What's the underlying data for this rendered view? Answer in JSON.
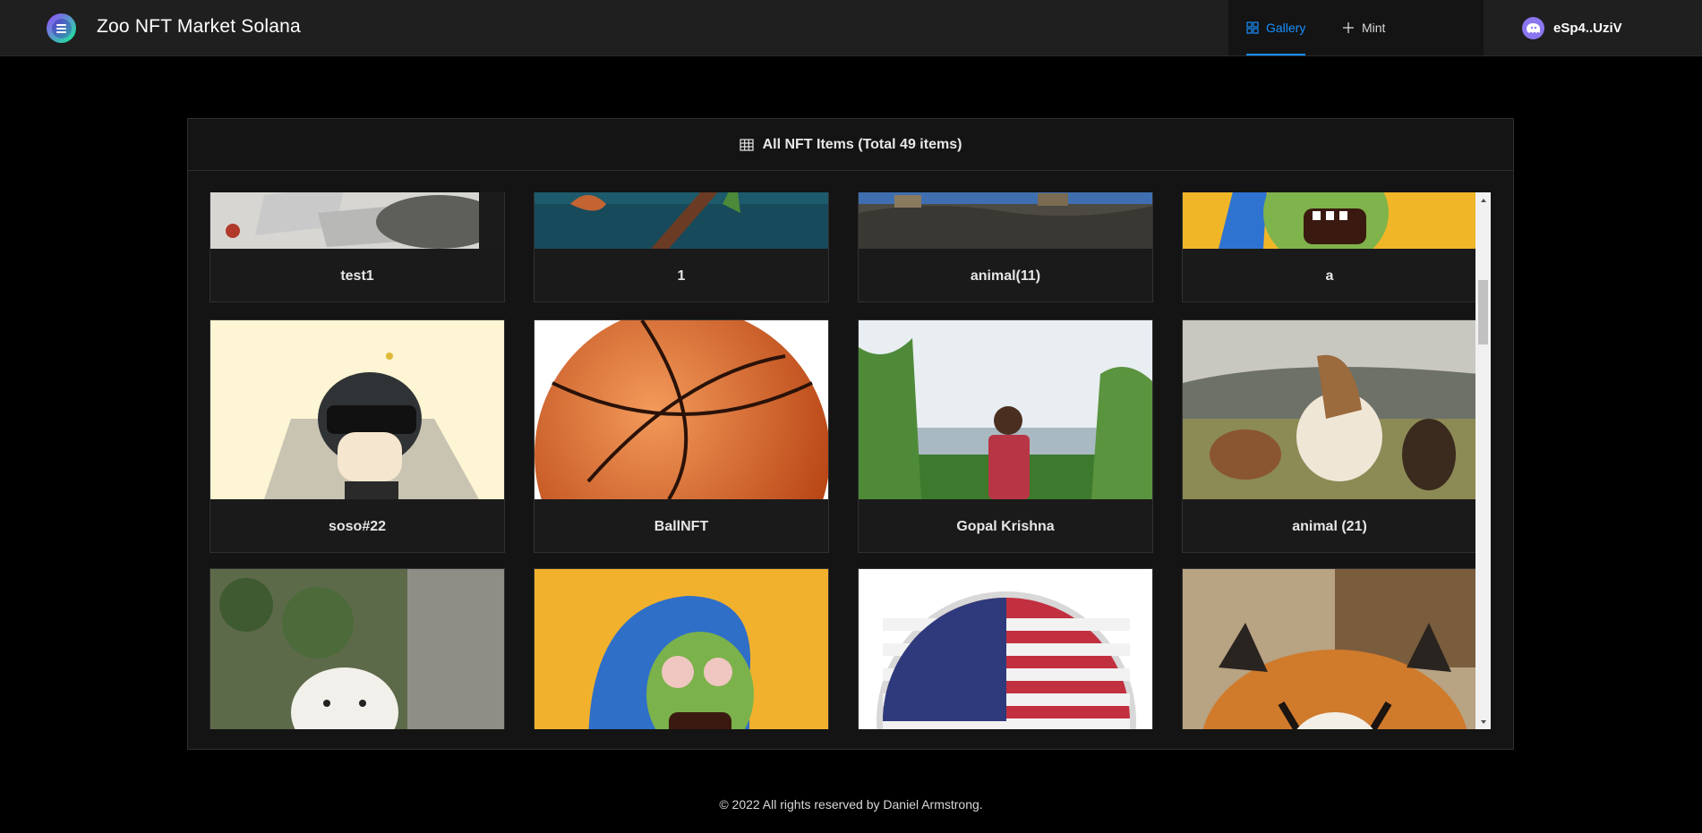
{
  "app": {
    "title": "Zoo NFT Market Solana"
  },
  "nav": {
    "gallery": "Gallery",
    "mint": "Mint"
  },
  "wallet": {
    "label": "eSp4..UziV"
  },
  "gallery": {
    "heading": "All NFT Items (Total 49 items)",
    "items": [
      {
        "name": "test1"
      },
      {
        "name": "1"
      },
      {
        "name": "animal(11)"
      },
      {
        "name": "a"
      },
      {
        "name": "soso#22"
      },
      {
        "name": "BallNFT"
      },
      {
        "name": "Gopal Krishna"
      },
      {
        "name": "animal (21)"
      },
      {
        "name": ""
      },
      {
        "name": ""
      },
      {
        "name": ""
      },
      {
        "name": ""
      }
    ]
  },
  "footer": {
    "text": "© 2022 All rights reserved by Daniel Armstrong."
  },
  "colors": {
    "accent": "#1890ff",
    "background": "#000000",
    "panel": "#141414"
  }
}
